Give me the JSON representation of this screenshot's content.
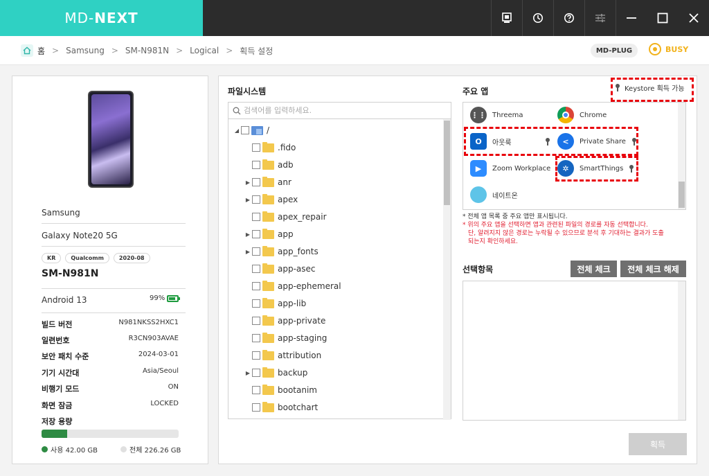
{
  "app": {
    "logo_light": "MD-",
    "logo_bold": "NEXT"
  },
  "titlebar": {
    "icons": [
      "report-icon",
      "history-icon",
      "help-icon",
      "settings-sliders-icon",
      "minimize-icon",
      "maximize-icon",
      "close-icon"
    ]
  },
  "breadcrumb": {
    "home": "홈",
    "items": [
      "Samsung",
      "SM-N981N",
      "Logical",
      "획득 설정"
    ]
  },
  "status": {
    "plug": "MD-PLUG",
    "busy": "BUSY",
    "busy_color": "#f2b21b"
  },
  "device": {
    "maker": "Samsung",
    "name": "Galaxy Note20 5G",
    "tags": [
      "KR",
      "Qualcomm",
      "2020-08"
    ],
    "model": "SM-N981N",
    "os": "Android 13",
    "battery": "99%",
    "battery_color": "#1f9b3f",
    "info": [
      {
        "key": "빌드 버전",
        "value": "N981NKSS2HXC1"
      },
      {
        "key": "일련번호",
        "value": "R3CN903AVAE"
      },
      {
        "key": "보안 패치 수준",
        "value": "2024-03-01"
      },
      {
        "key": "기기 시간대",
        "value": "Asia/Seoul"
      },
      {
        "key": "비행기 모드",
        "value": "ON"
      },
      {
        "key": "화면 잠금",
        "value": "LOCKED"
      }
    ],
    "storage_label": "저장 용량",
    "storage_used_fraction": 0.186,
    "used_label": "사용 42.00 GB",
    "total_label": "전체 226.26 GB"
  },
  "filesystem": {
    "title": "파일시스템",
    "search_placeholder": "검색어를 입력하세요.",
    "root": "/",
    "folders": [
      {
        "name": ".fido",
        "expandable": false
      },
      {
        "name": "adb",
        "expandable": false
      },
      {
        "name": "anr",
        "expandable": true
      },
      {
        "name": "apex",
        "expandable": true
      },
      {
        "name": "apex_repair",
        "expandable": false
      },
      {
        "name": "app",
        "expandable": true
      },
      {
        "name": "app_fonts",
        "expandable": true
      },
      {
        "name": "app-asec",
        "expandable": false
      },
      {
        "name": "app-ephemeral",
        "expandable": false
      },
      {
        "name": "app-lib",
        "expandable": false
      },
      {
        "name": "app-private",
        "expandable": false
      },
      {
        "name": "app-staging",
        "expandable": false
      },
      {
        "name": "attribution",
        "expandable": false
      },
      {
        "name": "backup",
        "expandable": true
      },
      {
        "name": "bootanim",
        "expandable": false
      },
      {
        "name": "bootchart",
        "expandable": false
      }
    ]
  },
  "apps": {
    "title": "주요 앱",
    "keystore_label": "Keystore 획득 가능",
    "list": [
      {
        "name": "Threema",
        "color": "#555555"
      },
      {
        "name": "Chrome",
        "color": "#db4437"
      },
      {
        "name": "아웃룩",
        "color": "#0a64c8"
      },
      {
        "name": "Private Share",
        "color": "#1a73e8"
      },
      {
        "name": "Zoom Workplace",
        "color": "#2d8cff"
      },
      {
        "name": "SmartThings",
        "color": "#1565c0"
      },
      {
        "name": "네이트온",
        "color": "#5ec4e8"
      }
    ],
    "note1": "* 전체 앱 목록 중 주요 앱만 표시됩니다.",
    "note2": "* 위의 주요 앱을 선택하면 앱과 관련된 파일의 경로를 자동 선택합니다.",
    "note3": "단, 알려지지 않은 경로는 누락될 수 있으므로 분석 후 기대하는 결과가 도출",
    "note4": "되는지 확인하세요."
  },
  "selection": {
    "title": "선택항목",
    "check_all": "전체 체크",
    "uncheck_all": "전체 체크 해제"
  },
  "acquire_label": "획득"
}
